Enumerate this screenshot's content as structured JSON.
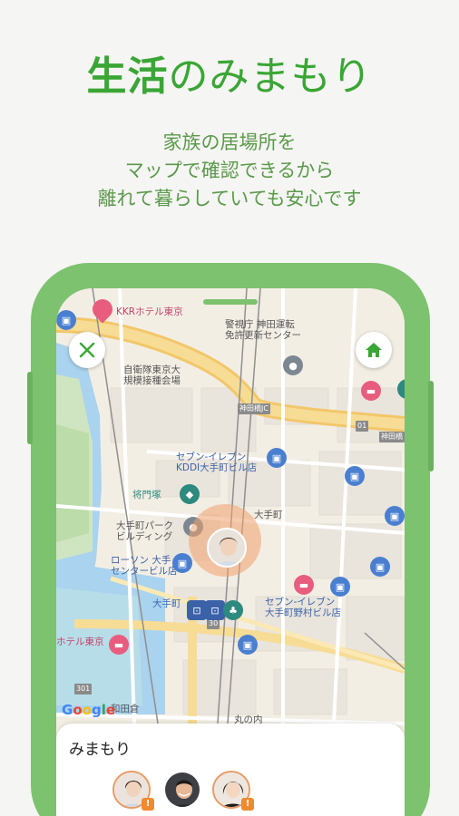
{
  "headline": {
    "strong": "生活",
    "light": "のみまもり"
  },
  "subtext": [
    "家族の居場所を",
    "マップで確認できるから",
    "離れて暮らしていても安心です"
  ],
  "colors": {
    "brand_green": "#3aa635",
    "phone_frame": "#7dc26f",
    "halo": "#f0a06e"
  },
  "map": {
    "labels": {
      "hotel_top": "KKRホテル東京",
      "police": "警視庁 神田運転\n免許更新センター",
      "jsdf": "自衛隊東京大\n規模接種会場",
      "kanda_bridge": "神田橋JC",
      "road_sign": "神田橋",
      "seven_1": "セブン-イレブン\nKDDI大手町ビル店",
      "masakado": "将門塚",
      "otemachi": "大手町",
      "park_building": "大手町パーク\nビルディング",
      "lawson": "ローソン 大手\nセンタービル店",
      "otemachi_station": "大手町",
      "seven_2": "セブン-イレブン\n大手町野村ビル店",
      "hotel_bottom": "ホテル東京",
      "wadakura": "和田倉",
      "marunouchi": "丸の内",
      "road_301": "301",
      "road_30": "30",
      "road_01": "01"
    },
    "google": "Google",
    "icons": {
      "close": "close-icon",
      "home": "home-icon"
    }
  },
  "sheet": {
    "title": "みまもり",
    "members": [
      "member-avatar-1",
      "member-avatar-2",
      "member-avatar-3"
    ],
    "warn_symbol": "!"
  }
}
